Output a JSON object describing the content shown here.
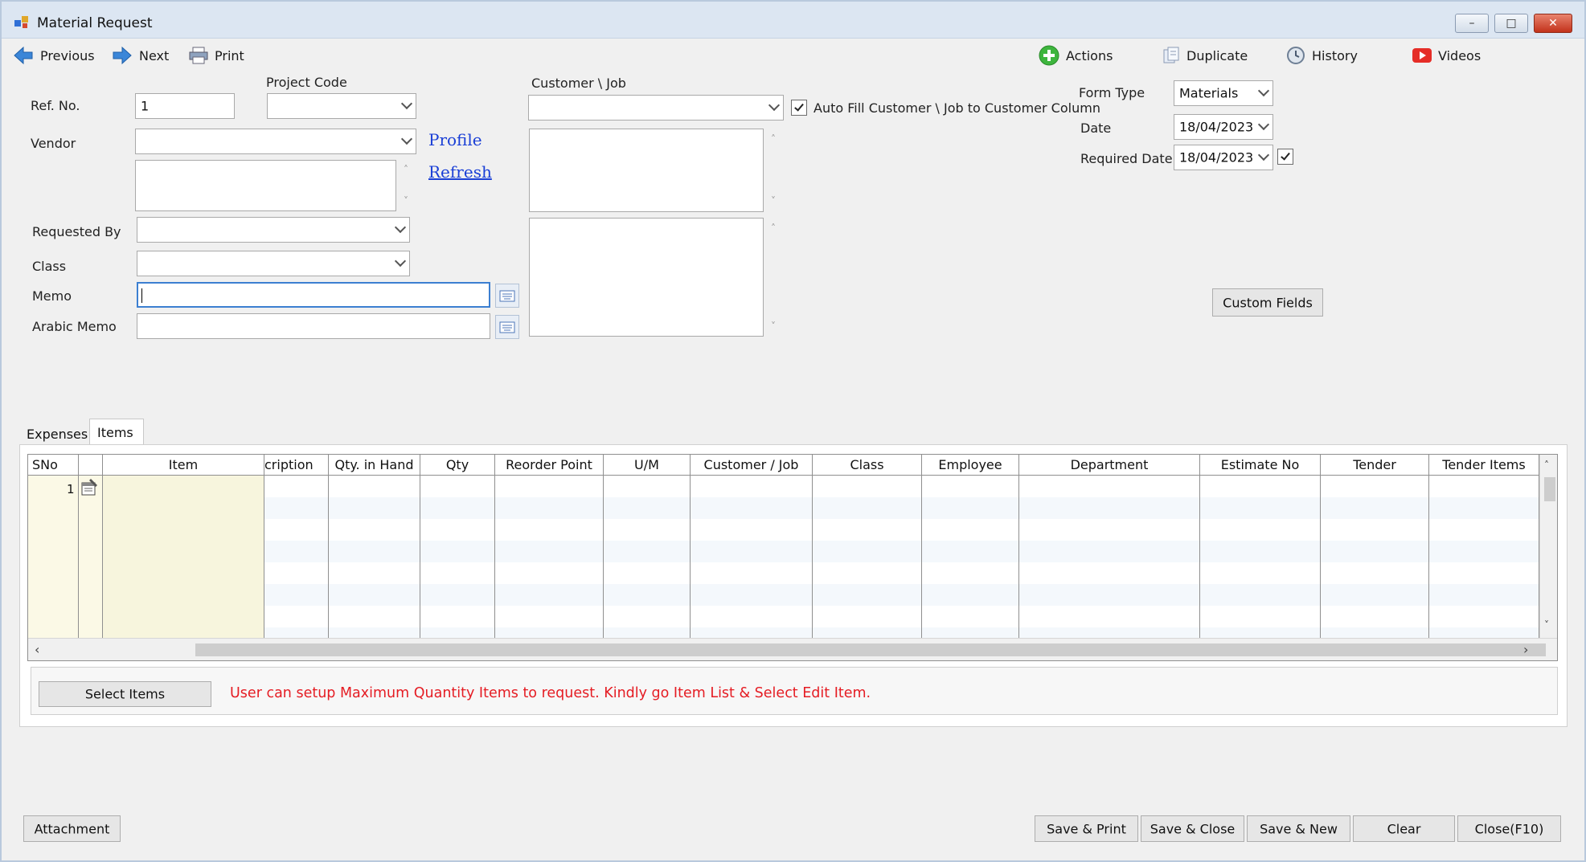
{
  "window": {
    "title": "Material Request",
    "minimize": "–",
    "maximize": "□",
    "close": "✕"
  },
  "toolbar": {
    "previous": "Previous",
    "next": "Next",
    "print": "Print",
    "actions": "Actions",
    "duplicate": "Duplicate",
    "history": "History",
    "videos": "Videos"
  },
  "form": {
    "ref_no_label": "Ref. No.",
    "ref_no_value": "1",
    "project_code_label": "Project Code",
    "project_code_value": "",
    "vendor_label": "Vendor",
    "vendor_value": "",
    "profile_link": "Profile",
    "refresh_link": "Refresh",
    "requested_by_label": "Requested By",
    "class_label": "Class",
    "memo_label": "Memo",
    "memo_value": "",
    "arabic_memo_label": "Arabic Memo",
    "arabic_memo_value": "",
    "customer_job_label": "Customer \\ Job",
    "auto_fill_label": "Auto Fill Customer \\ Job to Customer Column",
    "auto_fill_checked": true,
    "form_type_label": "Form Type",
    "form_type_value": "Materials",
    "date_label": "Date",
    "date_value": "18/04/2023",
    "required_date_label": "Required Date",
    "required_date_value": "18/04/2023",
    "required_date_checked": true,
    "custom_fields_button": "Custom Fields"
  },
  "tabs": [
    {
      "label": "Expenses",
      "active": false
    },
    {
      "label": "Items",
      "active": true
    }
  ],
  "grid": {
    "columns": [
      "SNo",
      "",
      "Item",
      "cription",
      "Qty. in Hand",
      "Qty",
      "Reorder Point",
      "U/M",
      "Customer / Job",
      "Class",
      "Employee",
      "Department",
      "Estimate No",
      "Tender",
      "Tender Items"
    ],
    "rows": [
      {
        "sno": "1"
      }
    ]
  },
  "items_panel": {
    "select_items_button": "Select Items",
    "info_message": "User can setup Maximum Quantity  Items to request. Kindly go Item List & Select Edit Item."
  },
  "footer": {
    "attachment": "Attachment",
    "save_print": "Save & Print",
    "save_close": "Save & Close",
    "save_new": "Save & New",
    "clear": "Clear",
    "close": "Close(F10)"
  },
  "colors": {
    "accent_link": "#1a3fd6",
    "info_text": "#e51c23",
    "item_column_bg": "#f7f5dd",
    "sno_column_bg": "#fbf9e6"
  }
}
